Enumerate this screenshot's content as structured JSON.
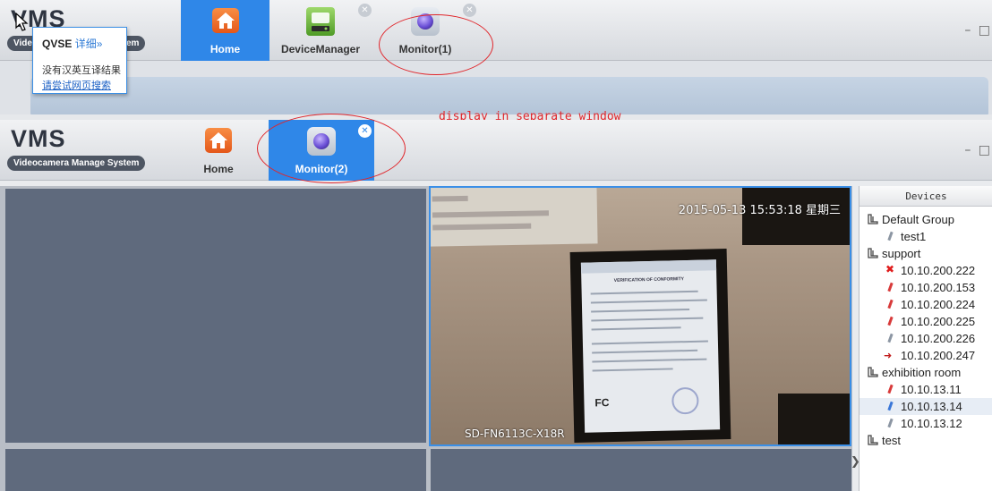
{
  "back_window": {
    "logo": "VMS",
    "logo_sub": "Videocamera Manage System",
    "tabs": [
      {
        "label": "Home",
        "icon": "home-icon",
        "active": true
      },
      {
        "label": "DeviceManager",
        "icon": "device-manager-icon",
        "active": false
      },
      {
        "label": "Monitor(1)",
        "icon": "camera-lens-icon",
        "active": false
      }
    ],
    "window_controls": "– □"
  },
  "tooltip": {
    "brand": "QVSE",
    "detail_link": "详细»",
    "no_result": "没有汉英互译结果",
    "search_link": "请尝试网页搜索"
  },
  "annotation": "display in separate window",
  "front_window": {
    "logo": "VMS",
    "logo_sub": "Videocamera Manage System",
    "tabs": [
      {
        "label": "Home",
        "icon": "home-icon",
        "active": false
      },
      {
        "label": "Monitor(2)",
        "icon": "camera-lens-icon",
        "active": true
      }
    ],
    "window_controls": "– □"
  },
  "video": {
    "timestamp": "2015-05-13 15:53:18 星期三",
    "camera_name": "SD-FN6113C-X18R",
    "doc_title": "VERIFICATION OF CONFORMITY",
    "doc_mark": "FC"
  },
  "devices": {
    "header": "Devices",
    "groups": [
      {
        "name": "Default Group",
        "items": [
          {
            "label": "test1",
            "status": "gray"
          }
        ]
      },
      {
        "name": "support",
        "items": [
          {
            "label": "10.10.200.222",
            "status": "error"
          },
          {
            "label": "10.10.200.153",
            "status": "red"
          },
          {
            "label": "10.10.200.224",
            "status": "red"
          },
          {
            "label": "10.10.200.225",
            "status": "red"
          },
          {
            "label": "10.10.200.226",
            "status": "gray"
          },
          {
            "label": "10.10.200.247",
            "status": "arrow"
          }
        ]
      },
      {
        "name": "exhibition room",
        "items": [
          {
            "label": "10.10.13.11",
            "status": "red"
          },
          {
            "label": "10.10.13.14",
            "status": "blue"
          },
          {
            "label": "10.10.13.12",
            "status": "gray"
          }
        ]
      },
      {
        "name": "test",
        "items": []
      }
    ]
  },
  "colors": {
    "tab_active": "#2f87e8",
    "annotation": "#e0262b",
    "cell_empty": "#5f6a7d",
    "cell_selected_border": "#3a8fe8"
  }
}
